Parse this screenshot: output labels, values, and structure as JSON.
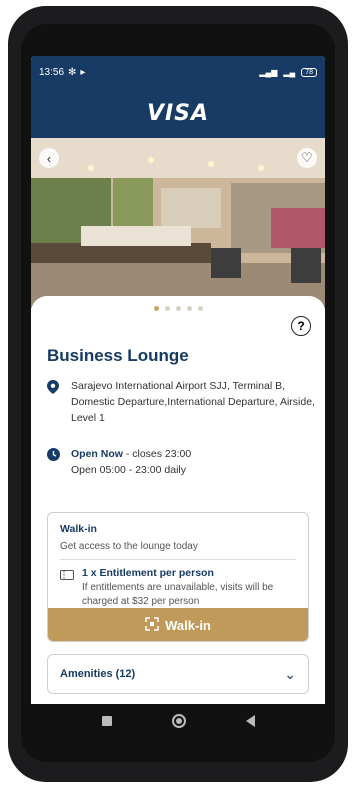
{
  "status_bar": {
    "time": "13:56",
    "battery": "78"
  },
  "header": {
    "brand": "VISA"
  },
  "hero": {
    "dots_total": 5,
    "active_dot": 0
  },
  "lounge": {
    "title": "Business Lounge",
    "address": "Sarajevo International Airport SJJ, Terminal B, Domestic Departure,International Departure, Airside, Level 1",
    "open_status": "Open Now",
    "closes": " - closes 23:00",
    "hours": "Open 05:00 - 23:00 daily"
  },
  "walkin_card": {
    "title": "Walk-in",
    "subtitle": "Get access to the lounge today",
    "entitlement_title": "1 x Entitlement per person",
    "entitlement_note": "If entitlements are unavailable, visits will be charged at $32 per person",
    "button_label": "Walk-in"
  },
  "amenities": {
    "label": "Amenities (12)"
  },
  "colors": {
    "navy": "#173b64",
    "gold": "#c09a5a"
  }
}
